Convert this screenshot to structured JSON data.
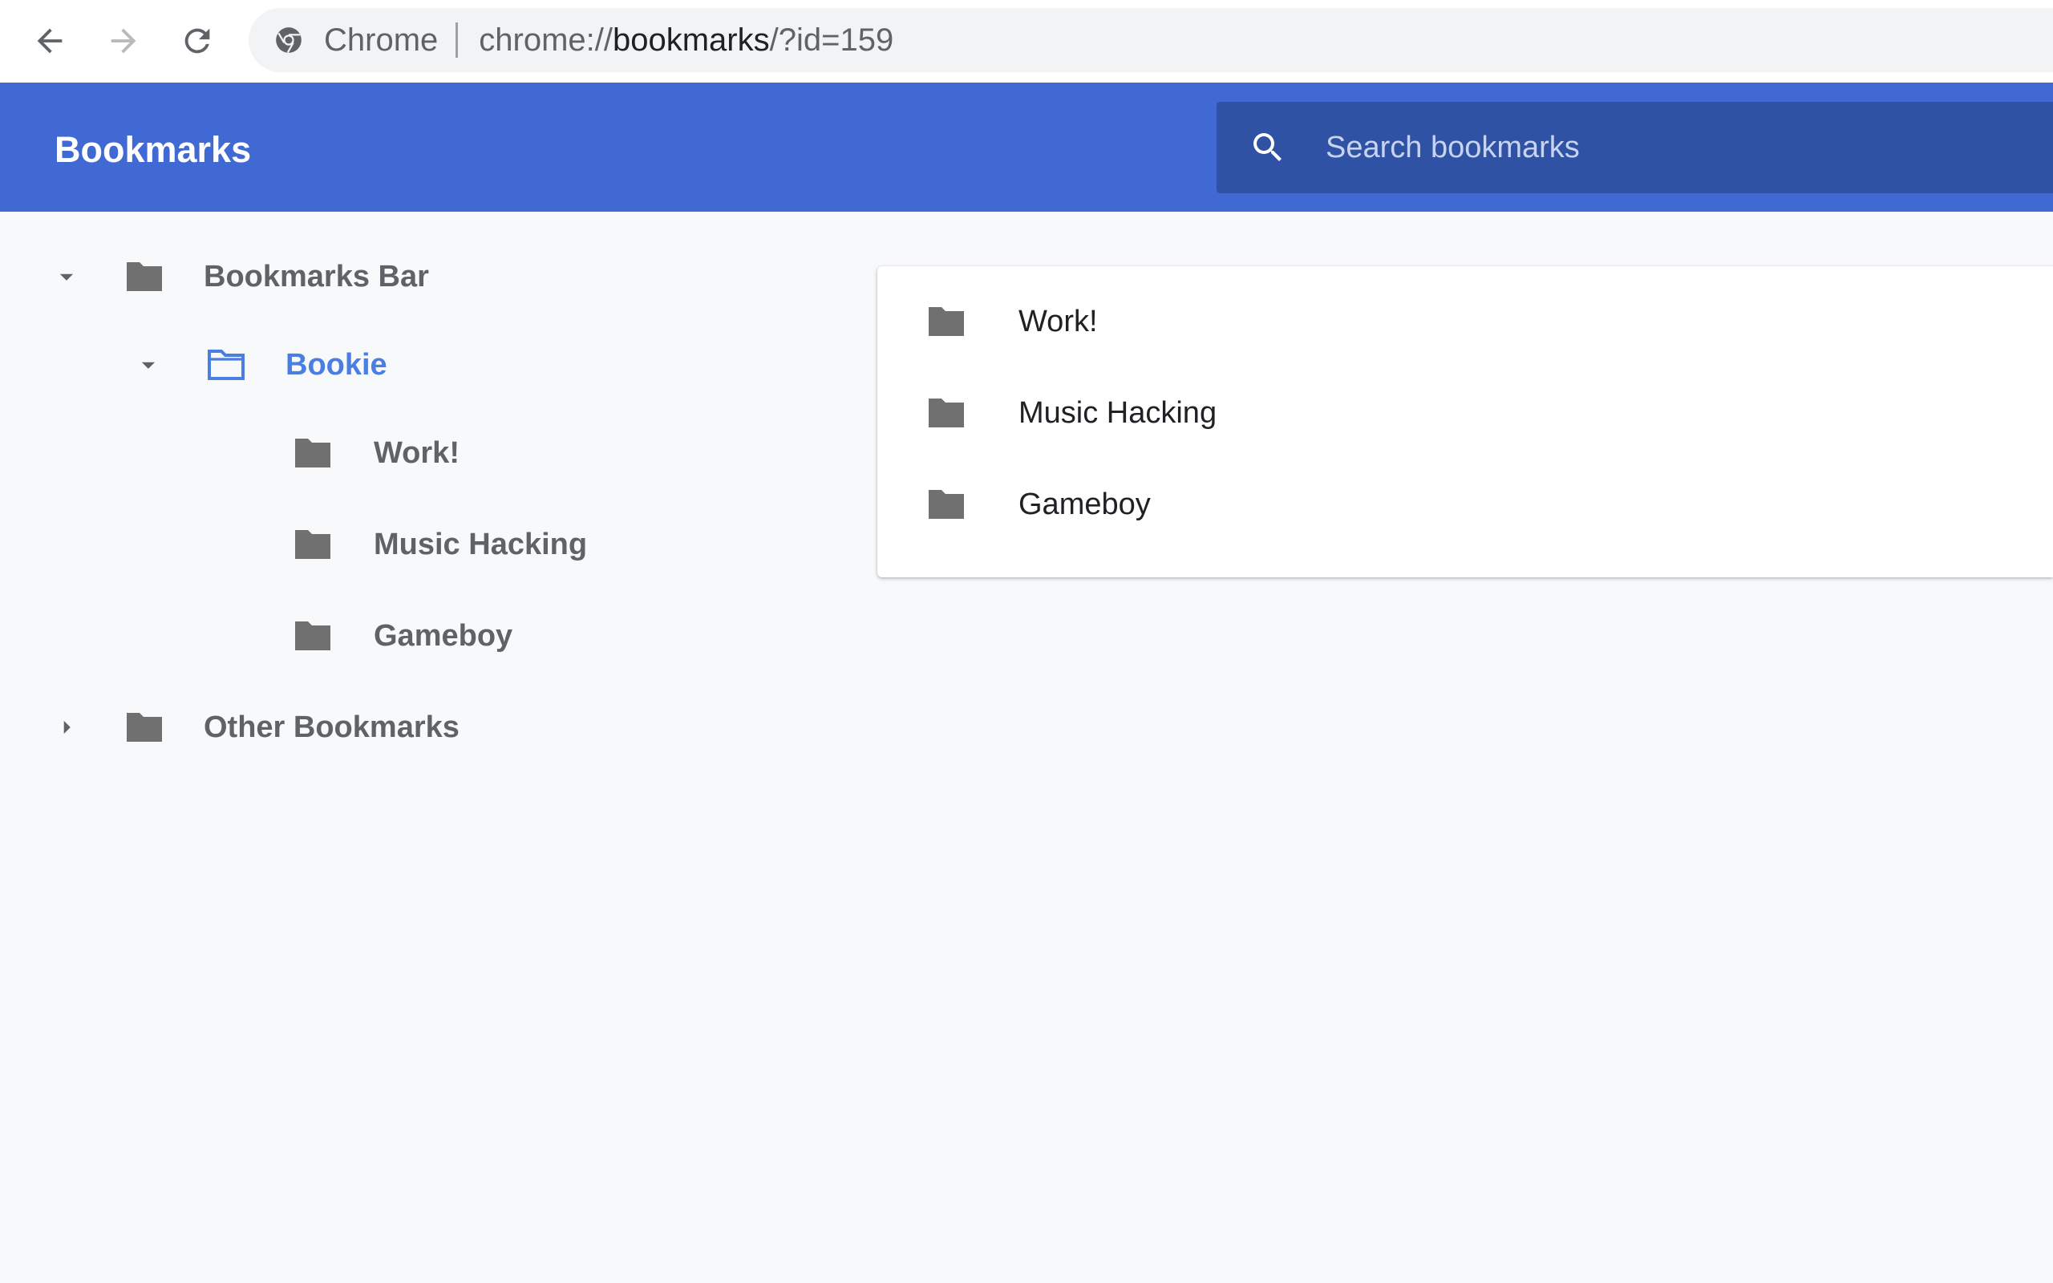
{
  "browser": {
    "site_label": "Chrome",
    "url_scheme": "chrome://",
    "url_host": "bookmarks",
    "url_path": "/?id=159",
    "icons": {
      "back": "back-arrow-icon",
      "forward": "forward-arrow-icon",
      "reload": "reload-icon",
      "site": "chrome-logo-icon"
    }
  },
  "header": {
    "title": "Bookmarks",
    "search_placeholder": "Search bookmarks",
    "search_value": ""
  },
  "sidebar": {
    "items": [
      {
        "label": "Bookmarks Bar",
        "expanded": true,
        "level": 0
      },
      {
        "label": "Bookie",
        "expanded": true,
        "selected": true,
        "level": 1
      },
      {
        "label": "Work!",
        "level": 2
      },
      {
        "label": "Music Hacking",
        "level": 2
      },
      {
        "label": "Gameboy",
        "level": 2
      },
      {
        "label": "Other Bookmarks",
        "expanded": false,
        "level": 0
      }
    ]
  },
  "list": {
    "items": [
      {
        "label": "Work!",
        "type": "folder"
      },
      {
        "label": "Music Hacking",
        "type": "folder"
      },
      {
        "label": "Gameboy",
        "type": "folder"
      }
    ]
  },
  "colors": {
    "header_bg": "#4169d3",
    "search_bg": "#2f52a4",
    "selected_text": "#4a7ee0",
    "folder_gray": "#707070",
    "page_bg": "#f8f9fa"
  }
}
